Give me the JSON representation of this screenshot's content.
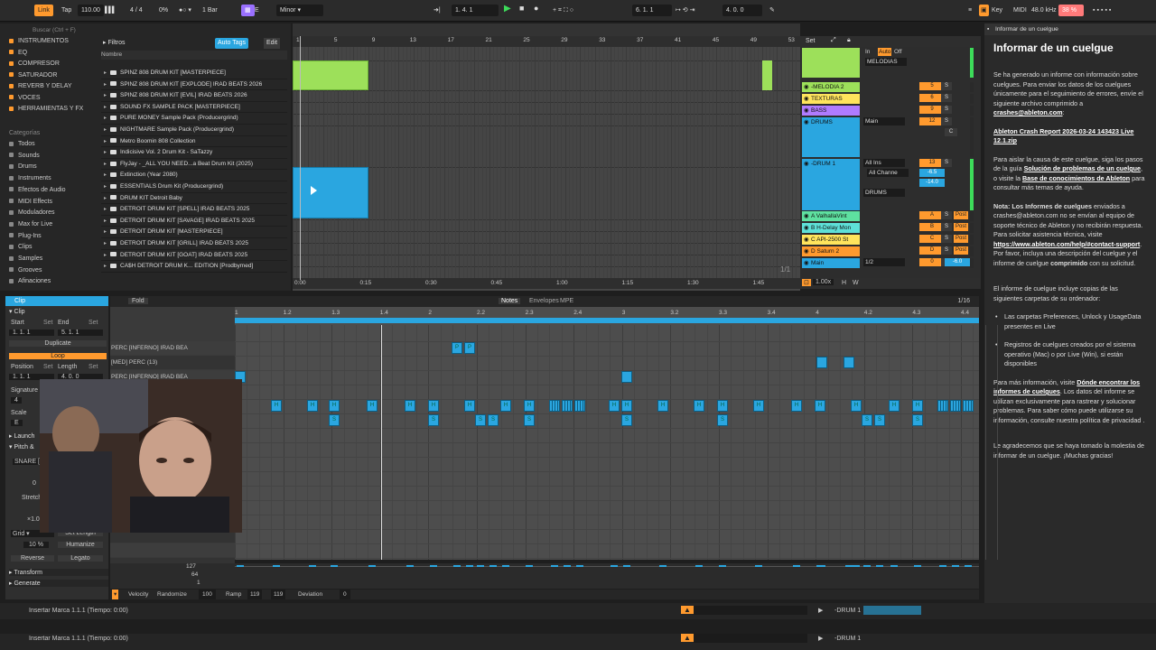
{
  "topbar": {
    "link": "Link",
    "tap": "Tap",
    "tempo": "110.00",
    "signature": "4 / 4",
    "cpu": "0%",
    "quant": "1 Bar",
    "key": "E",
    "scale": "Minor",
    "position": "1.  4.  1",
    "loop_start": "6.  1.  1",
    "loop_len": "4.  0.  0",
    "key_label": "Key",
    "midi_label": "MIDI",
    "sample_rate": "48.0 kHz",
    "cpu_meter": "38 %"
  },
  "browser": {
    "search_placeholder": "Buscar (Ctrl + F)",
    "filter_label": "Filtros",
    "autotags": "Auto Tags",
    "edit": "Edit",
    "column_header": "Nombre",
    "places": [
      "INSTRUMENTOS",
      "EQ",
      "COMPRESOR",
      "SATURADOR",
      "REVERB Y DELAY",
      "VOCES",
      "HERRAMIENTAS Y FX"
    ],
    "categories_header": "Categorías",
    "categories": [
      "Todos",
      "Sounds",
      "Drums",
      "Instruments",
      "Efectos de Audio",
      "MIDI Effects",
      "Moduladores",
      "Max for Live",
      "Plug-Ins",
      "Clips",
      "Samples",
      "Grooves",
      "Afinaciones"
    ],
    "files": [
      "SPINZ 808 DRUM KIT [MASTERPIECE]",
      "SPINZ 808 DRUM KIT [EXPLODE] IRAD BEATS 2026",
      "SPINZ 808 DRUM KIT [EVIL] IRAD BEATS 2026",
      "SOUND FX SAMPLE PACK [MASTERPIECE]",
      "PURE MONEY Sample Pack (Producergrind)",
      "NIGHTMARE Sample Pack (Producergrind)",
      "Metro Boomin 808 Collection",
      "Indicisive Vol. 2 Drum Kit - SaTazzy",
      "FlyJay - _ALL YOU NEED...a Beat Drum Kit (2025)",
      "Extinction (Year 2080)",
      "ESSENTIALS Drum Kit (Producergrind)",
      "DRUM KIT  Detroit Baby",
      "DETROIT DRUM KIT [SPELL] IRAD BEATS 2025",
      "DETROIT DRUM KIT [SAVAGE] IRAD BEATS 2025",
      "DETROIT DRUM KIT [MASTERPIECE]",
      "DETROIT DRUM KIT [GRILL] IRAD BEATS 2025",
      "DETROIT DRUM KIT [GOAT] IRAD BEATS 2025",
      "CA$H DETROIT DRUM K... EDITION [Prodbymed]"
    ]
  },
  "arrangement": {
    "bar_numbers": [
      "1",
      "5",
      "9",
      "13",
      "17",
      "21",
      "25",
      "29",
      "33",
      "37",
      "41",
      "45",
      "49",
      "53"
    ],
    "time_labels": [
      "0:00",
      "0:15",
      "0:30",
      "0:45",
      "1:00",
      "1:15",
      "1:30",
      "1:45"
    ],
    "page": "1/1",
    "set_label": "Set"
  },
  "mixer": {
    "tracks": [
      {
        "name": "MELODIAS",
        "color": "#9de05a",
        "num": "",
        "in": "MELODIAS"
      },
      {
        "name": "-MELODIA 2",
        "color": "#9de05a",
        "num": "5"
      },
      {
        "name": "TEXTURAS",
        "color": "#ffe45c",
        "num": "6"
      },
      {
        "name": "BASS",
        "color": "#b07bff",
        "num": "9"
      },
      {
        "name": "DRUMS",
        "color": "#2aa6e0",
        "num": "12",
        "routing": "Main"
      },
      {
        "name": "-DRUM 1",
        "color": "#2aa6e0",
        "num": "13",
        "input": "All Ins",
        "channel": "All Channe",
        "vol": "-6.5",
        "vol2": "-14.0",
        "out": "DRUMS"
      },
      {
        "name": "A ValhallaVint",
        "color": "#5ee0a0",
        "num": "A"
      },
      {
        "name": "B H-Delay Mon",
        "color": "#5ee0d8",
        "num": "B"
      },
      {
        "name": "C API-2500 St",
        "color": "#ffe45c",
        "num": "C"
      },
      {
        "name": "D Saturn 2",
        "color": "#ff9a2e",
        "num": "D"
      },
      {
        "name": "Main",
        "color": "#2aa6e0",
        "num": "0",
        "sends": "1/2",
        "vol": "-6.0"
      }
    ],
    "zoom": "1.00x",
    "h": "H",
    "w": "W",
    "in_label": "In",
    "auto_label": "Auto",
    "off_label": "Off",
    "dash": "-oo",
    "s": "S",
    "c": "C",
    "post": "Post"
  },
  "report": {
    "window_title": "Informar de un cuelgue",
    "heading": "Informar de un cuelgue",
    "p1_a": "Se ha generado un informe con información sobre cuelgues. Para enviar los datos de los cuelgues únicamente para el seguimiento de errores, envíe el siguiente archivo comprimido a ",
    "p1_link": "crashes@ableton.com",
    "p1_b": ":",
    "filename": "Ableton Crash Report 2026-03-24 143423 Live 12.1.zip",
    "p2_a": "Para aislar la causa de este cuelgue, siga los pasos de la guía ",
    "p2_link1": "Solución de problemas de un cuelgue",
    "p2_b": ", o visite la ",
    "p2_link2": "Base de conocimientos de Ableton",
    "p2_c": " para consultar más temas de ayuda.",
    "p3_a": "Nota: Los ",
    "p3_bold": "Informes de cuelgues",
    "p3_b": " enviados a crashes@ableton.com no se envían al equipo de soporte técnico de Ableton y no recibirán respuesta. Para solicitar asistencia técnica, visite ",
    "p3_link": "https://www.ableton.com/help/#contact-support",
    "p3_c": ". Por favor, incluya una descripción del cuelgue y el informe de cuelgue ",
    "p3_bold2": "comprimido",
    "p3_d": " con su solicitud.",
    "p4": "El informe de cuelgue incluye copias de las siguientes carpetas de su ordenador:",
    "li1": "Las carpetas Preferences, Unlock y UsageData presentes en Live",
    "li2": "Registros de cuelgues creados por el sistema operativo (Mac) o por Live (Win), si están disponibles",
    "p5_a": "Para más información, visite ",
    "p5_link": "Dónde encontrar los informes de cuelgues",
    "p5_b": ". Los datos del informe se utilizan exclusivamente para rastrear y solucionar problemas. Para saber cómo puede utilizarse su información, consulte nuestra política de privacidad .",
    "p6": "Le agradecemos que se haya tomado la molestia de informar de un cuelgue. ¡Muchas gracias!"
  },
  "clip": {
    "header": "Clip",
    "clip_label": "Clip",
    "start_label": "Start",
    "set_label": "Set",
    "end_label": "End",
    "start_val": "1.  1.  1",
    "end_val": "5.  1.  1",
    "duplicate": "Duplicate",
    "loop": "Loop",
    "position_label": "Position",
    "length_label": "Length",
    "position_val": "1.  1.  1",
    "length_val": "4.  0.  0",
    "signature_label": "Signature",
    "sig_val": "4",
    "scale_label": "Scale",
    "scale_val": "E",
    "launch": "Launch",
    "pitch": "Pitch &",
    "snare": "SNARE [",
    "zero": "0",
    "stretch": "Stretch",
    "stretch_val": "×1.0",
    "grid_label": "Grid",
    "set_length": "Set Length",
    "percent": "10 %",
    "humanize": "Humanize",
    "reverse": "Reverse",
    "legato": "Legato",
    "transform": "Transform",
    "generate": "Generate",
    "fold": "Fold"
  },
  "noteeditor": {
    "tabs": [
      "Notes",
      "Envelopes",
      "MPE"
    ],
    "grid_quant": "1/16",
    "ruler": [
      "1",
      "1.2",
      "1.3",
      "1.4",
      "2",
      "2.2",
      "2.3",
      "2.4",
      "3",
      "3.2",
      "3.3",
      "3.4",
      "4",
      "4.2",
      "4.3",
      "4.4"
    ],
    "lanes": [
      "PERC [INFERNO] IRAD BEA",
      "[MED] PERC (13)",
      "PERC [INFERNO] IRAD BEA"
    ]
  },
  "velocity": {
    "max": "127",
    "mid": "64",
    "min": "1",
    "velocity_label": "Velocity",
    "randomize": "Randomize",
    "rand_val": "100",
    "ramp": "Ramp",
    "ramp_a": "119",
    "ramp_b": "119",
    "deviation": "Deviation",
    "deviation_val": "0"
  },
  "status": {
    "message": "Insertar Marca 1.1.1 (Tiempo: 0:00)",
    "message2": "Insertar Marca 1.1.1 (Tiempo: 0:00)",
    "track": "-DRUM 1",
    "track2": "-DRUM 1"
  },
  "colors": {
    "accent_orange": "#ff9a2e",
    "clip_green": "#9de05a",
    "clip_blue": "#2aa6e0",
    "play_green": "#3ddc5a"
  }
}
